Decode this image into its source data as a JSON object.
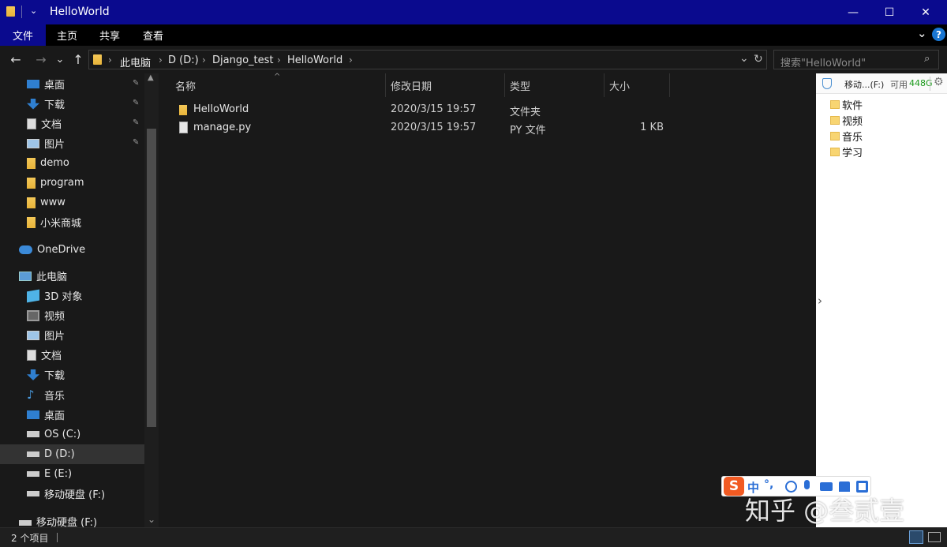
{
  "window": {
    "title": "HelloWorld",
    "minimize": "—",
    "maximize": "☐",
    "close": "✕"
  },
  "ribbon": {
    "tabs": [
      "文件",
      "主页",
      "共享",
      "查看"
    ],
    "expand": "⌄",
    "help": "?"
  },
  "address": {
    "back": "←",
    "forward": "→",
    "recent": "⌄",
    "up": "↑",
    "crumbs": [
      "此电脑",
      "D (D:)",
      "Django_test",
      "HelloWorld"
    ],
    "separator": "›",
    "search_placeholder": "搜索\"HelloWorld\""
  },
  "sidebar": {
    "quick": [
      {
        "label": "桌面",
        "icon": "desktop-icon",
        "pinned": true
      },
      {
        "label": "下载",
        "icon": "download-icon",
        "pinned": true
      },
      {
        "label": "文档",
        "icon": "document-icon",
        "pinned": true
      },
      {
        "label": "图片",
        "icon": "picture-icon",
        "pinned": true
      },
      {
        "label": "demo",
        "icon": "folder-icon",
        "pinned": false
      },
      {
        "label": "program",
        "icon": "folder-icon",
        "pinned": false
      },
      {
        "label": "www",
        "icon": "folder-icon",
        "pinned": false
      },
      {
        "label": "小米商城",
        "icon": "folder-icon",
        "pinned": false
      }
    ],
    "onedrive": "OneDrive",
    "thispc": "此电脑",
    "pc_items": [
      {
        "label": "3D 对象",
        "icon": "3d-objects-icon"
      },
      {
        "label": "视频",
        "icon": "video-icon"
      },
      {
        "label": "图片",
        "icon": "picture-icon"
      },
      {
        "label": "文档",
        "icon": "document-icon"
      },
      {
        "label": "下载",
        "icon": "download-icon"
      },
      {
        "label": "音乐",
        "icon": "music-icon"
      },
      {
        "label": "桌面",
        "icon": "desktop-icon"
      },
      {
        "label": "OS (C:)",
        "icon": "windows-drive-icon"
      },
      {
        "label": "D (D:)",
        "icon": "drive-icon",
        "selected": true
      },
      {
        "label": "E (E:)",
        "icon": "drive-icon"
      },
      {
        "label": "移动硬盘 (F:)",
        "icon": "drive-icon"
      }
    ],
    "removable": "移动硬盘 (F:)"
  },
  "columns": {
    "name": "名称",
    "date": "修改日期",
    "type": "类型",
    "size": "大小"
  },
  "files": [
    {
      "name": "HelloWorld",
      "date": "2020/3/15 19:57",
      "type": "文件夹",
      "size": "",
      "icon": "folder-icon"
    },
    {
      "name": "manage.py",
      "date": "2020/3/15 19:57",
      "type": "PY 文件",
      "size": "1 KB",
      "icon": "file-icon"
    }
  ],
  "right_panel": {
    "drive": "移动...(F:)",
    "free_label": "可用",
    "free_value": "448G",
    "folders": [
      "软件",
      "视频",
      "音乐",
      "学习"
    ]
  },
  "ime": {
    "lang": "中",
    "punct": "°,"
  },
  "watermark": "知乎 @叁贰壹",
  "status": {
    "count": "2 个项目"
  },
  "colors": {
    "titlebar": "#0a0a8e",
    "ribbon_active": "#0a0a8e",
    "background": "#191919",
    "folder": "#f0c048",
    "selected": "#333333",
    "accent_green": "#1a9a1a"
  }
}
